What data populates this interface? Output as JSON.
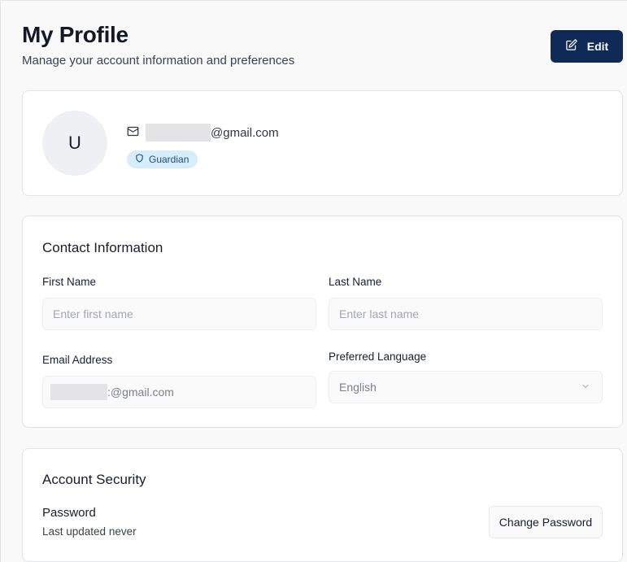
{
  "header": {
    "title": "My Profile",
    "subtitle": "Manage your account information and preferences",
    "edit_label": "Edit"
  },
  "profile": {
    "avatar_initial": "U",
    "email_suffix": "@gmail.com",
    "role_badge": "Guardian"
  },
  "contact": {
    "title": "Contact Information",
    "first_name_label": "First Name",
    "first_name_placeholder": "Enter first name",
    "last_name_label": "Last Name",
    "last_name_placeholder": "Enter last name",
    "email_label": "Email Address",
    "email_value_suffix": ":@gmail.com",
    "language_label": "Preferred Language",
    "language_value": "English"
  },
  "security": {
    "title": "Account Security",
    "password_label": "Password",
    "password_sub": "Last updated never",
    "change_password_label": "Change Password"
  },
  "colors": {
    "primary_button": "#0f2a55",
    "badge_bg": "#d8edfb",
    "badge_text": "#1e4e7c"
  },
  "icons": {
    "edit": "pencil-square-icon",
    "email": "mail-icon",
    "badge": "shield-icon",
    "select": "chevron-down-icon"
  }
}
